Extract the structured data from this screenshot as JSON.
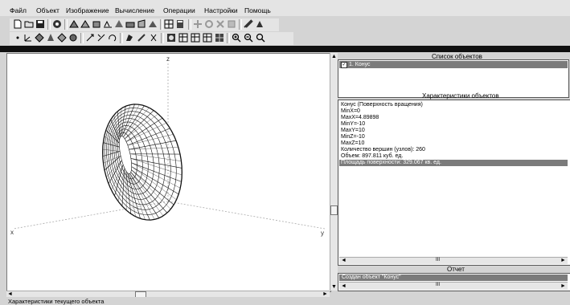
{
  "menu": {
    "items": [
      "Файл",
      "Объект",
      "Изображение",
      "Вычисление",
      "Операции",
      "Настройки",
      "Помощь"
    ]
  },
  "toolbar1": {
    "icons": [
      "new-icon",
      "open-icon",
      "save-icon",
      "info-icon",
      "shape-icon",
      "shape-icon",
      "shape-icon",
      "shape-icon",
      "shape-icon",
      "shape-icon",
      "shape-icon",
      "shape-icon",
      "grid-icon",
      "calc-icon",
      "move-icon",
      "rotate-icon",
      "scale-icon",
      "delete-icon",
      "tool-icon",
      "tool-icon"
    ]
  },
  "toolbar2": {
    "icons": [
      "point-icon",
      "axis-icon",
      "shape-icon",
      "shape-icon",
      "shape-icon",
      "shape-icon",
      "pointer-icon",
      "move-icon",
      "rotate-icon",
      "paint-icon",
      "brush-icon",
      "cut-icon",
      "render-icon",
      "grid-icon",
      "grid-icon",
      "grid-icon",
      "grid-icon",
      "zoom-in-icon",
      "zoom-out-icon",
      "zoom-fit-icon"
    ]
  },
  "viewport": {
    "axis_z": "z",
    "axis_x": "x",
    "axis_y": "y"
  },
  "object_list": {
    "title": "Список объектов",
    "items": [
      {
        "label": "1. Конус",
        "checked": true
      }
    ]
  },
  "characteristics": {
    "title": "Характеристики объектов",
    "lines": [
      "Конус (Поверхность вращения)",
      "MinX=0",
      "MaxX=4.89898",
      "MinY=-10",
      "MaxY=10",
      "MinZ=-10",
      "MaxZ=10",
      "Количество вершин (узлов): 260",
      "Объем: 897.811 куб. ед.",
      "Площадь поверхности: 329.067 кв. ед."
    ],
    "selected_line": "Площадь поверхности: 329.067 кв. ед.",
    "scroll_label": "III"
  },
  "report": {
    "title": "Отчет",
    "line": "Создан объект \"Конус\"",
    "scroll_label": "III"
  },
  "status_bar": {
    "text": "Характеристики текущего объекта"
  }
}
